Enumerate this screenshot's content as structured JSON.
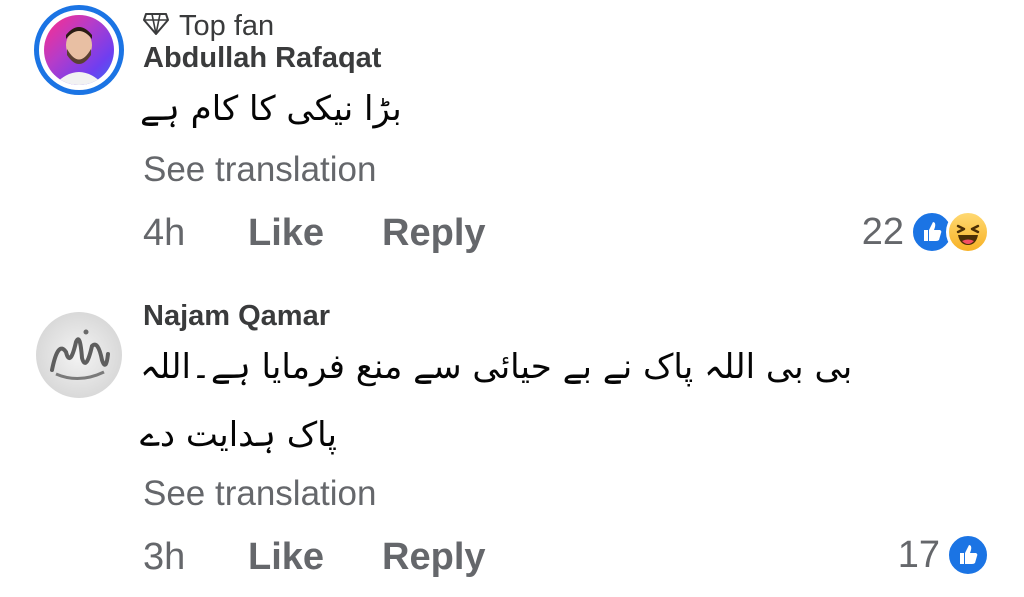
{
  "comments": [
    {
      "badge": "Top fan",
      "name": "Abdullah Rafaqat",
      "text": "بڑا نیکی کا کام ہے",
      "translate_label": "See translation",
      "time": "4h",
      "like_label": "Like",
      "reply_label": "Reply",
      "reaction_count": "22",
      "reactions": [
        "like-icon",
        "haha-icon"
      ]
    },
    {
      "name": "Najam Qamar",
      "text_line1": "بی بی اللہ پاک نے بے حیائی سے منع فرمایا ہے۔اللہ",
      "text_line2": "پاک ہدایت دے",
      "translate_label": "See translation",
      "time": "3h",
      "like_label": "Like",
      "reply_label": "Reply",
      "reaction_count": "17",
      "reactions": [
        "like-icon"
      ]
    }
  ],
  "colors": {
    "accent": "#1b74e4",
    "secondary_text": "#65676b",
    "name_text": "#3a3b3c"
  }
}
